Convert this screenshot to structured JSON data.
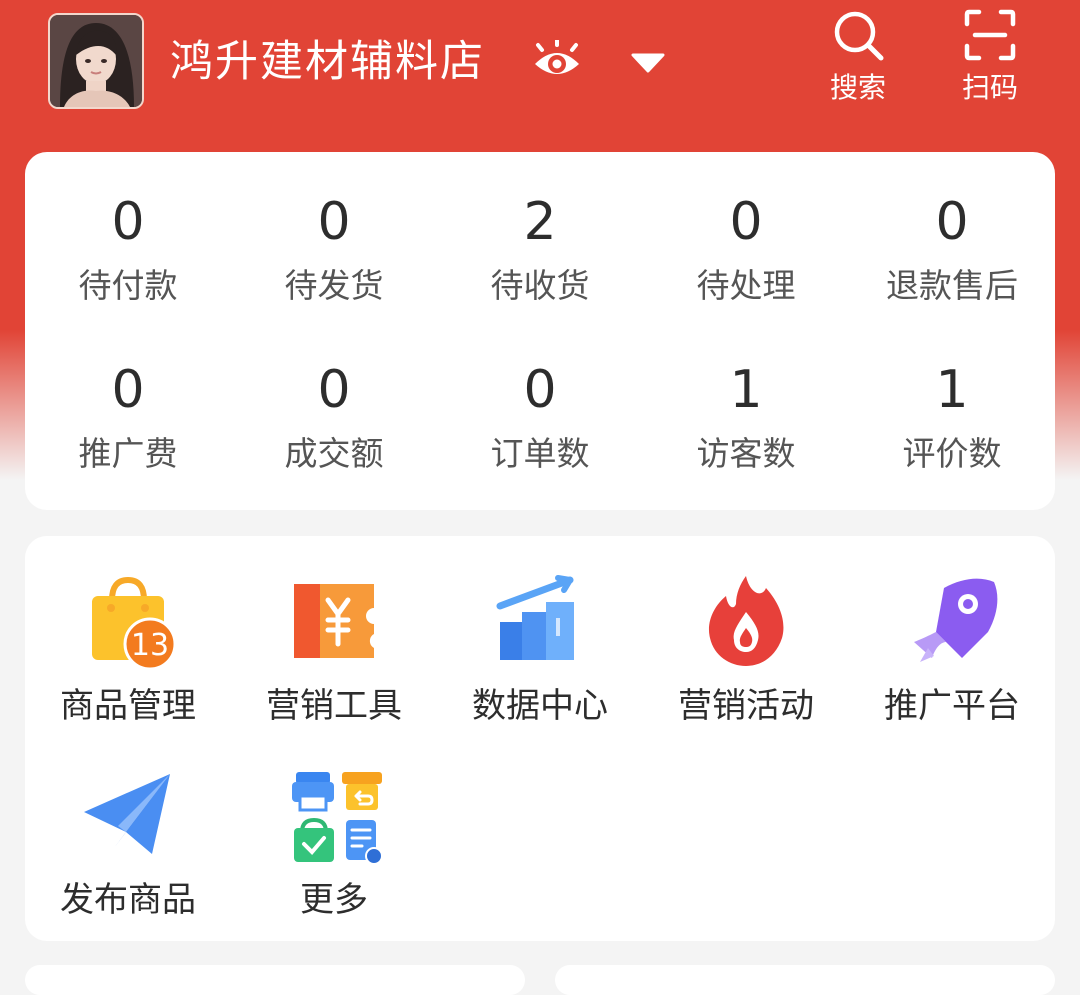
{
  "header": {
    "shop_name": "鸿升建材辅料店",
    "avatar": "avatar",
    "view_icon": "eye-icon",
    "dropdown_icon": "caret-down-icon",
    "search_label": "搜索",
    "scan_label": "扫码",
    "brand_color": "#e14436"
  },
  "stats": [
    {
      "value": "0",
      "label": "待付款"
    },
    {
      "value": "0",
      "label": "待发货"
    },
    {
      "value": "2",
      "label": "待收货"
    },
    {
      "value": "0",
      "label": "待处理"
    },
    {
      "value": "0",
      "label": "退款售后"
    },
    {
      "value": "0",
      "label": "推广费"
    },
    {
      "value": "0",
      "label": "成交额"
    },
    {
      "value": "0",
      "label": "订单数"
    },
    {
      "value": "1",
      "label": "访客数"
    },
    {
      "value": "1",
      "label": "评价数"
    }
  ],
  "menu": [
    {
      "label": "商品管理",
      "icon": "shopping-bag-icon",
      "badge": "13"
    },
    {
      "label": "营销工具",
      "icon": "coupon-icon"
    },
    {
      "label": "数据中心",
      "icon": "bar-chart-icon"
    },
    {
      "label": "营销活动",
      "icon": "flame-icon"
    },
    {
      "label": "推广平台",
      "icon": "rocket-icon"
    },
    {
      "label": "发布商品",
      "icon": "paper-plane-icon"
    },
    {
      "label": "更多",
      "icon": "more-apps-icon"
    }
  ]
}
